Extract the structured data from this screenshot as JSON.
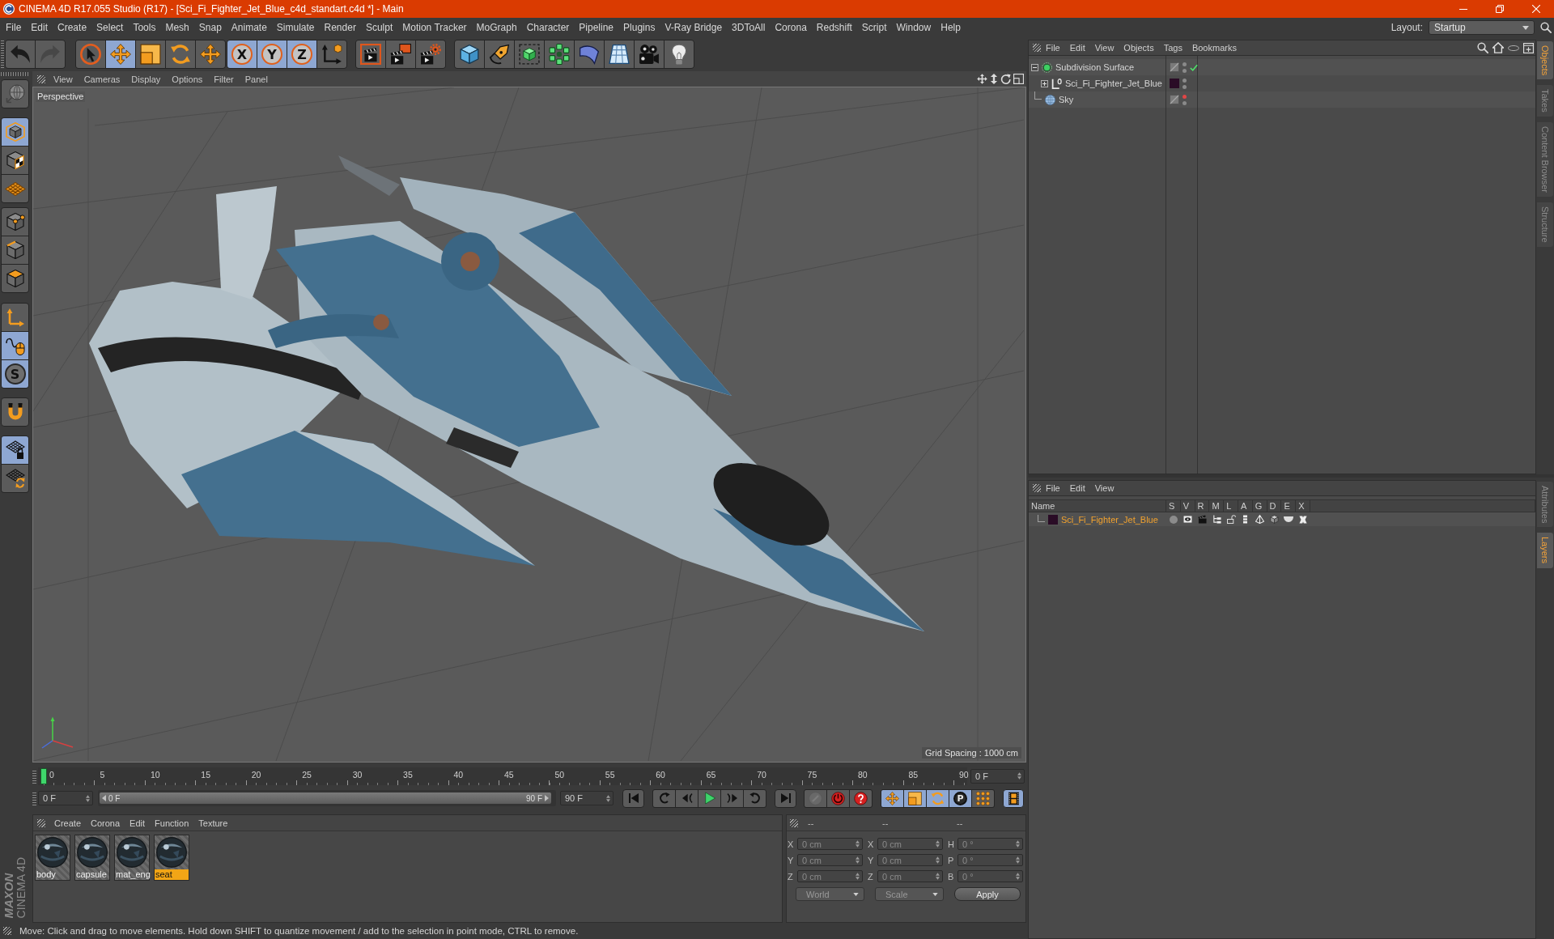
{
  "window": {
    "title": "CINEMA 4D R17.055 Studio (R17) - [Sci_Fi_Fighter_Jet_Blue_c4d_standart.c4d *] - Main"
  },
  "menu": [
    "File",
    "Edit",
    "Create",
    "Select",
    "Tools",
    "Mesh",
    "Snap",
    "Animate",
    "Simulate",
    "Render",
    "Sculpt",
    "Motion Tracker",
    "MoGraph",
    "Character",
    "Pipeline",
    "Plugins",
    "V-Ray Bridge",
    "3DToAll",
    "Corona",
    "Redshift",
    "Script",
    "Window",
    "Help"
  ],
  "layout": {
    "label": "Layout:",
    "value": "Startup"
  },
  "toolbar": [
    [
      {
        "selected": false,
        "disabled": false
      },
      {
        "selected": false,
        "disabled": true
      }
    ],
    [
      {
        "selected": false,
        "disabled": false
      },
      {
        "selected": true,
        "disabled": false
      },
      {
        "selected": false,
        "disabled": false
      },
      {
        "selected": false,
        "disabled": false
      },
      {
        "selected": false,
        "disabled": false
      }
    ],
    [
      {
        "label": "X",
        "selected": true,
        "disabled": false
      },
      {
        "label": "Y",
        "selected": true,
        "disabled": false
      },
      {
        "label": "Z",
        "selected": true,
        "disabled": false
      },
      {
        "selected": false,
        "disabled": false
      }
    ],
    [
      {
        "selected": false,
        "disabled": false
      },
      {
        "selected": false,
        "disabled": false
      },
      {
        "selected": false,
        "disabled": false
      }
    ],
    [
      {
        "selected": false,
        "disabled": false
      },
      {
        "selected": false,
        "disabled": false
      },
      {
        "selected": false,
        "disabled": false
      },
      {
        "selected": false,
        "disabled": false
      },
      {
        "selected": false,
        "disabled": false
      },
      {
        "selected": false,
        "disabled": false
      },
      {
        "selected": false,
        "disabled": false
      },
      {
        "selected": false,
        "disabled": false
      }
    ]
  ],
  "mode_toolbar": [
    [
      {
        "selected": false
      }
    ],
    [
      {
        "selected": true
      },
      {
        "selected": false
      },
      {
        "selected": false
      }
    ],
    [
      {
        "selected": false
      },
      {
        "selected": false
      },
      {
        "selected": false
      }
    ],
    [
      {
        "selected": false
      },
      {
        "selected": true
      },
      {
        "label": "S",
        "selected": true
      }
    ],
    [
      {
        "selected": false
      }
    ],
    [
      {
        "selected": true
      },
      {
        "selected": false
      }
    ]
  ],
  "viewport": {
    "menu": [
      "View",
      "Cameras",
      "Display",
      "Options",
      "Filter",
      "Panel"
    ],
    "camera": "Perspective",
    "grid_spacing": "Grid Spacing : 1000 cm"
  },
  "timeline": {
    "ruler": [
      "0",
      "5",
      "10",
      "15",
      "20",
      "25",
      "30",
      "35",
      "40",
      "45",
      "50",
      "55",
      "60",
      "65",
      "70",
      "75",
      "80",
      "85",
      "90"
    ],
    "playhead": {
      "level": 0
    },
    "current_frame": "0 F",
    "min_field": "0 F",
    "preview_range": {
      "start": "0 F",
      "end": "90 F",
      "level": 1
    },
    "max_field": "90 F",
    "record_buttons": [
      {
        "disabled": true
      },
      {
        "disabled": false
      },
      {
        "disabled": false
      }
    ],
    "key_buttons": [
      {
        "selected": true
      },
      {
        "selected": true
      },
      {
        "selected": true
      },
      {
        "label": "P",
        "selected": true
      },
      {
        "selected": false
      }
    ],
    "timeline_button": {
      "selected": true
    }
  },
  "materials": {
    "menu": [
      "Create",
      "Corona",
      "Edit",
      "Function",
      "Texture"
    ],
    "items": [
      {
        "name": "body",
        "selected": false
      },
      {
        "name": "capsule",
        "selected": false
      },
      {
        "name": "mat_eng",
        "selected": false
      },
      {
        "name": "seat",
        "selected": true
      }
    ]
  },
  "coordinates": {
    "headers": [
      "--",
      "--",
      "--"
    ],
    "columns": [
      [
        {
          "axis": "X",
          "value": "0 cm"
        },
        {
          "axis": "Y",
          "value": "0 cm"
        },
        {
          "axis": "Z",
          "value": "0 cm"
        }
      ],
      [
        {
          "axis": "X",
          "value": "0 cm"
        },
        {
          "axis": "Y",
          "value": "0 cm"
        },
        {
          "axis": "Z",
          "value": "0 cm"
        }
      ],
      [
        {
          "axis": "H",
          "value": "0 °"
        },
        {
          "axis": "P",
          "value": "0 °"
        },
        {
          "axis": "B",
          "value": "0 °"
        }
      ]
    ],
    "dropdowns": [
      "World",
      "Scale"
    ],
    "apply": "Apply"
  },
  "status_bar": "Move: Click and drag to move elements. Hold down SHIFT to quantize movement / add to the selection in point mode, CTRL to remove.",
  "logo": {
    "brand": "MAXON",
    "product": "CINEMA 4D"
  },
  "objects": {
    "menu": [
      "File",
      "Edit",
      "View",
      "Objects",
      "Tags",
      "Bookmarks"
    ],
    "tree": [
      {
        "name": "Subdivision Surface",
        "kind": "generator",
        "expanded": true,
        "enabled": true,
        "editor_hidden": false,
        "children": [
          {
            "name": "Sci_Fi_Fighter_Jet_Blue",
            "kind": "null",
            "expanded": false,
            "color": "#2a0c26",
            "editor_hidden": false
          }
        ]
      },
      {
        "name": "Sky",
        "kind": "sky",
        "editor_hidden": true
      }
    ]
  },
  "layers": {
    "menu": [
      "File",
      "Edit",
      "View"
    ],
    "columns": [
      "Name",
      "S",
      "V",
      "R",
      "M",
      "L",
      "A",
      "G",
      "D",
      "E",
      "X"
    ],
    "rows": [
      {
        "name": "Sci_Fi_Fighter_Jet_Blue",
        "color": "#2a0c26"
      }
    ]
  },
  "side_tabs": {
    "upper": [
      {
        "label": "Objects",
        "selected": true
      },
      {
        "label": "Takes",
        "selected": false
      },
      {
        "label": "Content Browser",
        "selected": false
      },
      {
        "label": "Structure",
        "selected": false
      }
    ],
    "lower": [
      {
        "label": "Attributes",
        "selected": false
      },
      {
        "label": "Layers",
        "selected": true
      }
    ]
  }
}
